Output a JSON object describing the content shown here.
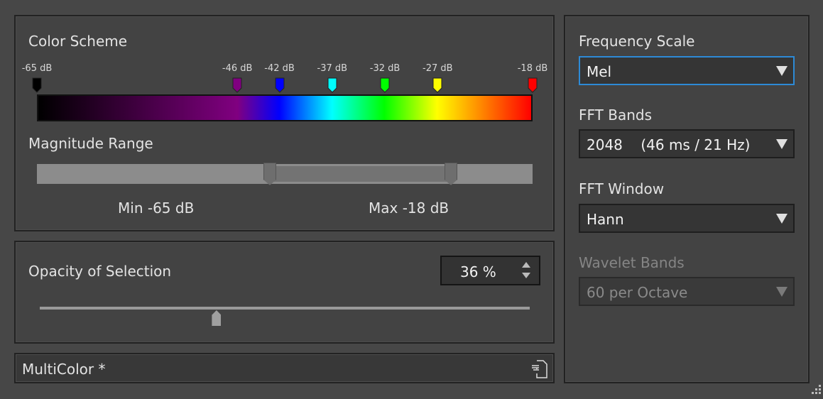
{
  "color_scheme": {
    "title": "Color Scheme",
    "stops": [
      {
        "db": -65,
        "label": "-65 dB",
        "color": "#000000"
      },
      {
        "db": -46,
        "label": "-46 dB",
        "color": "#800080"
      },
      {
        "db": -42,
        "label": "-42 dB",
        "color": "#0000ff"
      },
      {
        "db": -37,
        "label": "-37 dB",
        "color": "#00ffff"
      },
      {
        "db": -32,
        "label": "-32 dB",
        "color": "#00ff00"
      },
      {
        "db": -27,
        "label": "-27 dB",
        "color": "#ffff00"
      },
      {
        "db": -18,
        "label": "-18 dB",
        "color": "#ff0000"
      }
    ],
    "range_min": -65,
    "range_max": -18
  },
  "magnitude": {
    "title": "Magnitude Range",
    "min_label": "Min -65 dB",
    "max_label": "Max -18 dB"
  },
  "opacity": {
    "title": "Opacity of Selection",
    "value_label": "36 %",
    "value": 0.36
  },
  "preset": {
    "name": "MultiColor *",
    "icon": "document-list-icon"
  },
  "right": {
    "freq_scale": {
      "label": "Frequency Scale",
      "value": "Mel"
    },
    "fft_bands": {
      "label": "FFT Bands",
      "value": "2048    (46 ms / 21 Hz)"
    },
    "fft_window": {
      "label": "FFT Window",
      "value": "Hann"
    },
    "wavelet": {
      "label": "Wavelet Bands",
      "value": "60 per Octave"
    }
  }
}
